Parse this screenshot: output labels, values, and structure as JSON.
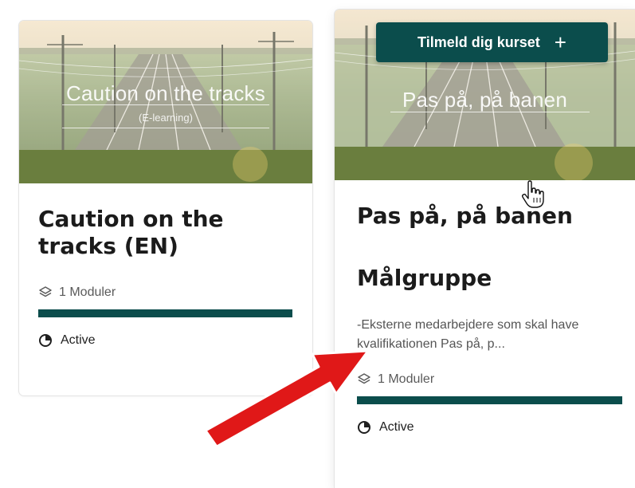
{
  "cards": [
    {
      "banner_title": "Caution on the tracks",
      "banner_subtitle": "(E-learning)",
      "title_line1": "Caution on the",
      "title_line2": "tracks (EN)",
      "modules": "1 Moduler",
      "status": "Active"
    },
    {
      "banner_title": "Pas på, på banen",
      "enroll_label": "Tilmeld dig kurset",
      "enroll_icon": "+",
      "title": "Pas på, på banen",
      "section_title": "Målgruppe",
      "description": "-Eksterne medarbejdere som skal have kvalifikationen Pas på, p...",
      "modules": "1 Moduler",
      "status": "Active"
    }
  ],
  "colors": {
    "accent": "#0b4d4c",
    "annotation_arrow": "#e01818"
  },
  "icons": {
    "modules": "layers-icon",
    "status": "half-circle-clock-icon",
    "enroll": "plus-icon",
    "cursor": "hand-pointer-icon",
    "annotation": "red-arrow"
  }
}
